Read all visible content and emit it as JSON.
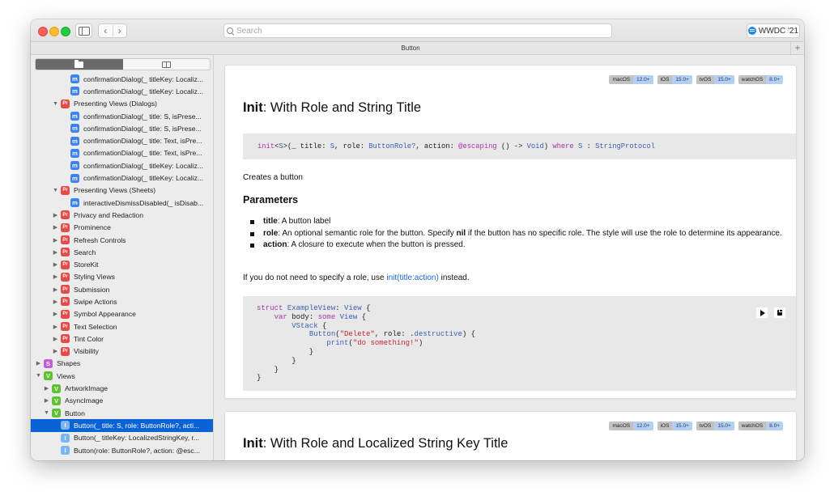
{
  "toolbar": {
    "search_placeholder": "Search",
    "wwdc_label": "WWDC '21",
    "back_label": "‹",
    "forward_label": "›"
  },
  "tab": {
    "title": "Button",
    "add_label": "+"
  },
  "sidebar": {
    "segments": [
      "folder-icon",
      "book-icon"
    ],
    "items": [
      {
        "indent": 3,
        "disc": "",
        "badge": "m",
        "label": "confirmationDialog(_ titleKey: Localiz..."
      },
      {
        "indent": 3,
        "disc": "",
        "badge": "m",
        "label": "confirmationDialog(_ titleKey: Localiz..."
      },
      {
        "indent": 2,
        "disc": "▼",
        "badge": "Pr",
        "label": "Presenting Views (Dialogs)"
      },
      {
        "indent": 3,
        "disc": "",
        "badge": "m",
        "label": "confirmationDialog(_ title: S, isPrese..."
      },
      {
        "indent": 3,
        "disc": "",
        "badge": "m",
        "label": "confirmationDialog(_ title: S, isPrese..."
      },
      {
        "indent": 3,
        "disc": "",
        "badge": "m",
        "label": "confirmationDialog(_ title: Text, isPre..."
      },
      {
        "indent": 3,
        "disc": "",
        "badge": "m",
        "label": "confirmationDialog(_ title: Text, isPre..."
      },
      {
        "indent": 3,
        "disc": "",
        "badge": "m",
        "label": "confirmationDialog(_ titleKey: Localiz..."
      },
      {
        "indent": 3,
        "disc": "",
        "badge": "m",
        "label": "confirmationDialog(_ titleKey: Localiz..."
      },
      {
        "indent": 2,
        "disc": "▼",
        "badge": "Pr",
        "label": "Presenting Views (Sheets)"
      },
      {
        "indent": 3,
        "disc": "",
        "badge": "m",
        "label": "interactiveDismissDisabled(_ isDisab..."
      },
      {
        "indent": 2,
        "disc": "▶",
        "badge": "Pr",
        "label": "Privacy and Redaction"
      },
      {
        "indent": 2,
        "disc": "▶",
        "badge": "Pr",
        "label": "Prominence"
      },
      {
        "indent": 2,
        "disc": "▶",
        "badge": "Pr",
        "label": "Refresh Controls"
      },
      {
        "indent": 2,
        "disc": "▶",
        "badge": "Pr",
        "label": "Search"
      },
      {
        "indent": 2,
        "disc": "▶",
        "badge": "Pr",
        "label": "StoreKit"
      },
      {
        "indent": 2,
        "disc": "▶",
        "badge": "Pr",
        "label": "Styling Views"
      },
      {
        "indent": 2,
        "disc": "▶",
        "badge": "Pr",
        "label": "Submission"
      },
      {
        "indent": 2,
        "disc": "▶",
        "badge": "Pr",
        "label": "Swipe Actions"
      },
      {
        "indent": 2,
        "disc": "▶",
        "badge": "Pr",
        "label": "Symbol Appearance"
      },
      {
        "indent": 2,
        "disc": "▶",
        "badge": "Pr",
        "label": "Text Selection"
      },
      {
        "indent": 2,
        "disc": "▶",
        "badge": "Pr",
        "label": "Tint Color"
      },
      {
        "indent": 2,
        "disc": "▶",
        "badge": "Pr",
        "label": "Visibility"
      },
      {
        "indent": 0,
        "disc": "▶",
        "badge": "S",
        "label": "Shapes"
      },
      {
        "indent": 0,
        "disc": "▼",
        "badge": "V",
        "label": "Views"
      },
      {
        "indent": 1,
        "disc": "▶",
        "badge": "V",
        "label": "ArtworkImage"
      },
      {
        "indent": 1,
        "disc": "▶",
        "badge": "V",
        "label": "AsyncImage"
      },
      {
        "indent": 1,
        "disc": "▼",
        "badge": "V",
        "label": "Button"
      },
      {
        "indent": 2,
        "disc": "",
        "badge": "I",
        "label": "Button(_ title: S, role: ButtonRole?, acti...",
        "selected": true
      },
      {
        "indent": 2,
        "disc": "",
        "badge": "I",
        "label": "Button(_ titleKey: LocalizedStringKey, r..."
      },
      {
        "indent": 2,
        "disc": "",
        "badge": "I",
        "label": "Button(role: ButtonRole?, action: @esc..."
      }
    ]
  },
  "platforms": [
    {
      "name": "macOS",
      "version": "12.0+"
    },
    {
      "name": "iOS",
      "version": "15.0+"
    },
    {
      "name": "tvOS",
      "version": "15.0+"
    },
    {
      "name": "watchOS",
      "version": "8.0+"
    }
  ],
  "doc": {
    "title_bold": "Init",
    "title_rest": ": With Role and String Title",
    "declaration": {
      "init": "init",
      "generic_open": "<",
      "generic_S": "S",
      "generic_close": ">",
      "sig_a": "(_ title: ",
      "sig_S": "S",
      "sig_b": ", role: ",
      "sig_role": "ButtonRole?",
      "sig_c": ", action: ",
      "sig_escaping": "@escaping",
      "sig_d": " () -> ",
      "sig_void": "Void",
      "sig_e": ") ",
      "sig_where": "where",
      "sig_f": " ",
      "sig_S2": "S",
      "sig_g": " : ",
      "sig_proto": "StringProtocol"
    },
    "summary": "Creates a button",
    "parameters_heading": "Parameters",
    "params": [
      {
        "name": "title",
        "desc": ": A button label"
      },
      {
        "name": "role",
        "desc_a": ": An optional semantic role for the button. Specify ",
        "nil": "nil",
        "desc_b": " if the button has no specific role. The style will use the role to determine its appearance."
      },
      {
        "name": "action",
        "desc": ": A closure to execute when the button is pressed."
      }
    ],
    "note_a": "If you do not need to specify a role, use ",
    "note_link": "init(title:action)",
    "note_b": " instead.",
    "code": {
      "l1_kw": "struct",
      "l1_sp": " ",
      "l1_ty": "ExampleView",
      "l1_a": ": ",
      "l1_ty2": "View",
      "l1_b": " {",
      "l2_indent": "    ",
      "l2_kw": "var",
      "l2_a": " body: ",
      "l2_kw2": "some",
      "l2_sp": " ",
      "l2_ty": "View",
      "l2_b": " {",
      "l3_indent": "        ",
      "l3_ty": "VStack",
      "l3_a": " {",
      "l4_indent": "            ",
      "l4_ty": "Button",
      "l4_a": "(",
      "l4_str": "\"Delete\"",
      "l4_b": ", role: .",
      "l4_ty2": "destructive",
      "l4_c": ") {",
      "l5_indent": "                ",
      "l5_ty": "print",
      "l5_a": "(",
      "l5_str": "\"do something!\"",
      "l5_b": ")",
      "l6": "            }",
      "l7": "        }",
      "l8": "    }",
      "l9": "}"
    }
  },
  "doc2": {
    "title_bold": "Init",
    "title_rest": ": With Role and Localized String Key Title"
  }
}
